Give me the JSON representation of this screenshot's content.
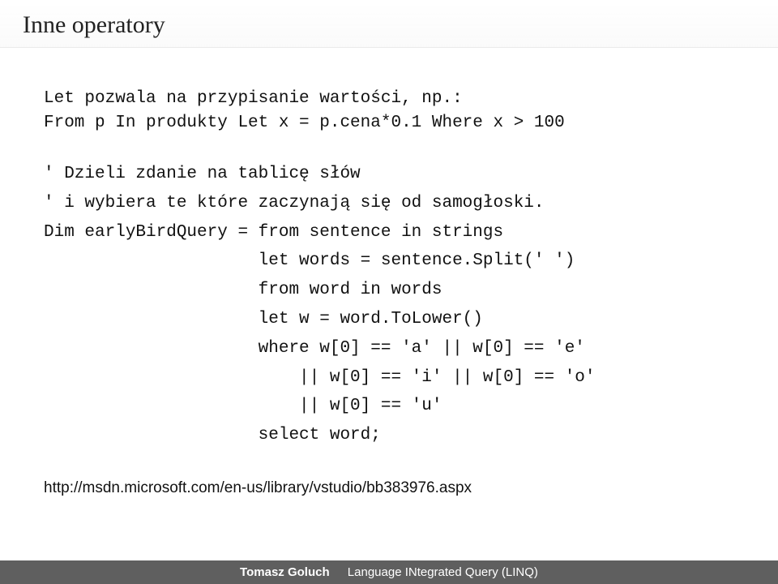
{
  "title": "Inne operatory",
  "intro_line1": "Let pozwala na przypisanie wartości, np.:",
  "intro_line2": "From p In produkty Let x = p.cena*0.1 Where x > 100",
  "comment1": "' Dzieli zdanie na tablicę słów",
  "comment2": "' i wybiera te które zaczynają się od samogłoski.",
  "code_l1": "Dim earlyBirdQuery = from sentence in strings",
  "code_l2": "                     let words = sentence.Split(' ')",
  "code_l3": "                     from word in words",
  "code_l4": "                     let w = word.ToLower()",
  "code_l5": "                     where w[0] == 'a' || w[0] == 'e'",
  "code_l6": "                         || w[0] == 'i' || w[0] == 'o'",
  "code_l7": "                         || w[0] == 'u'",
  "code_l8": "                     select word;",
  "link": "http://msdn.microsoft.com/en-us/library/vstudio/bb383976.aspx",
  "footer": {
    "author": "Tomasz Goluch",
    "course": "Language INtegrated Query (LINQ)"
  }
}
